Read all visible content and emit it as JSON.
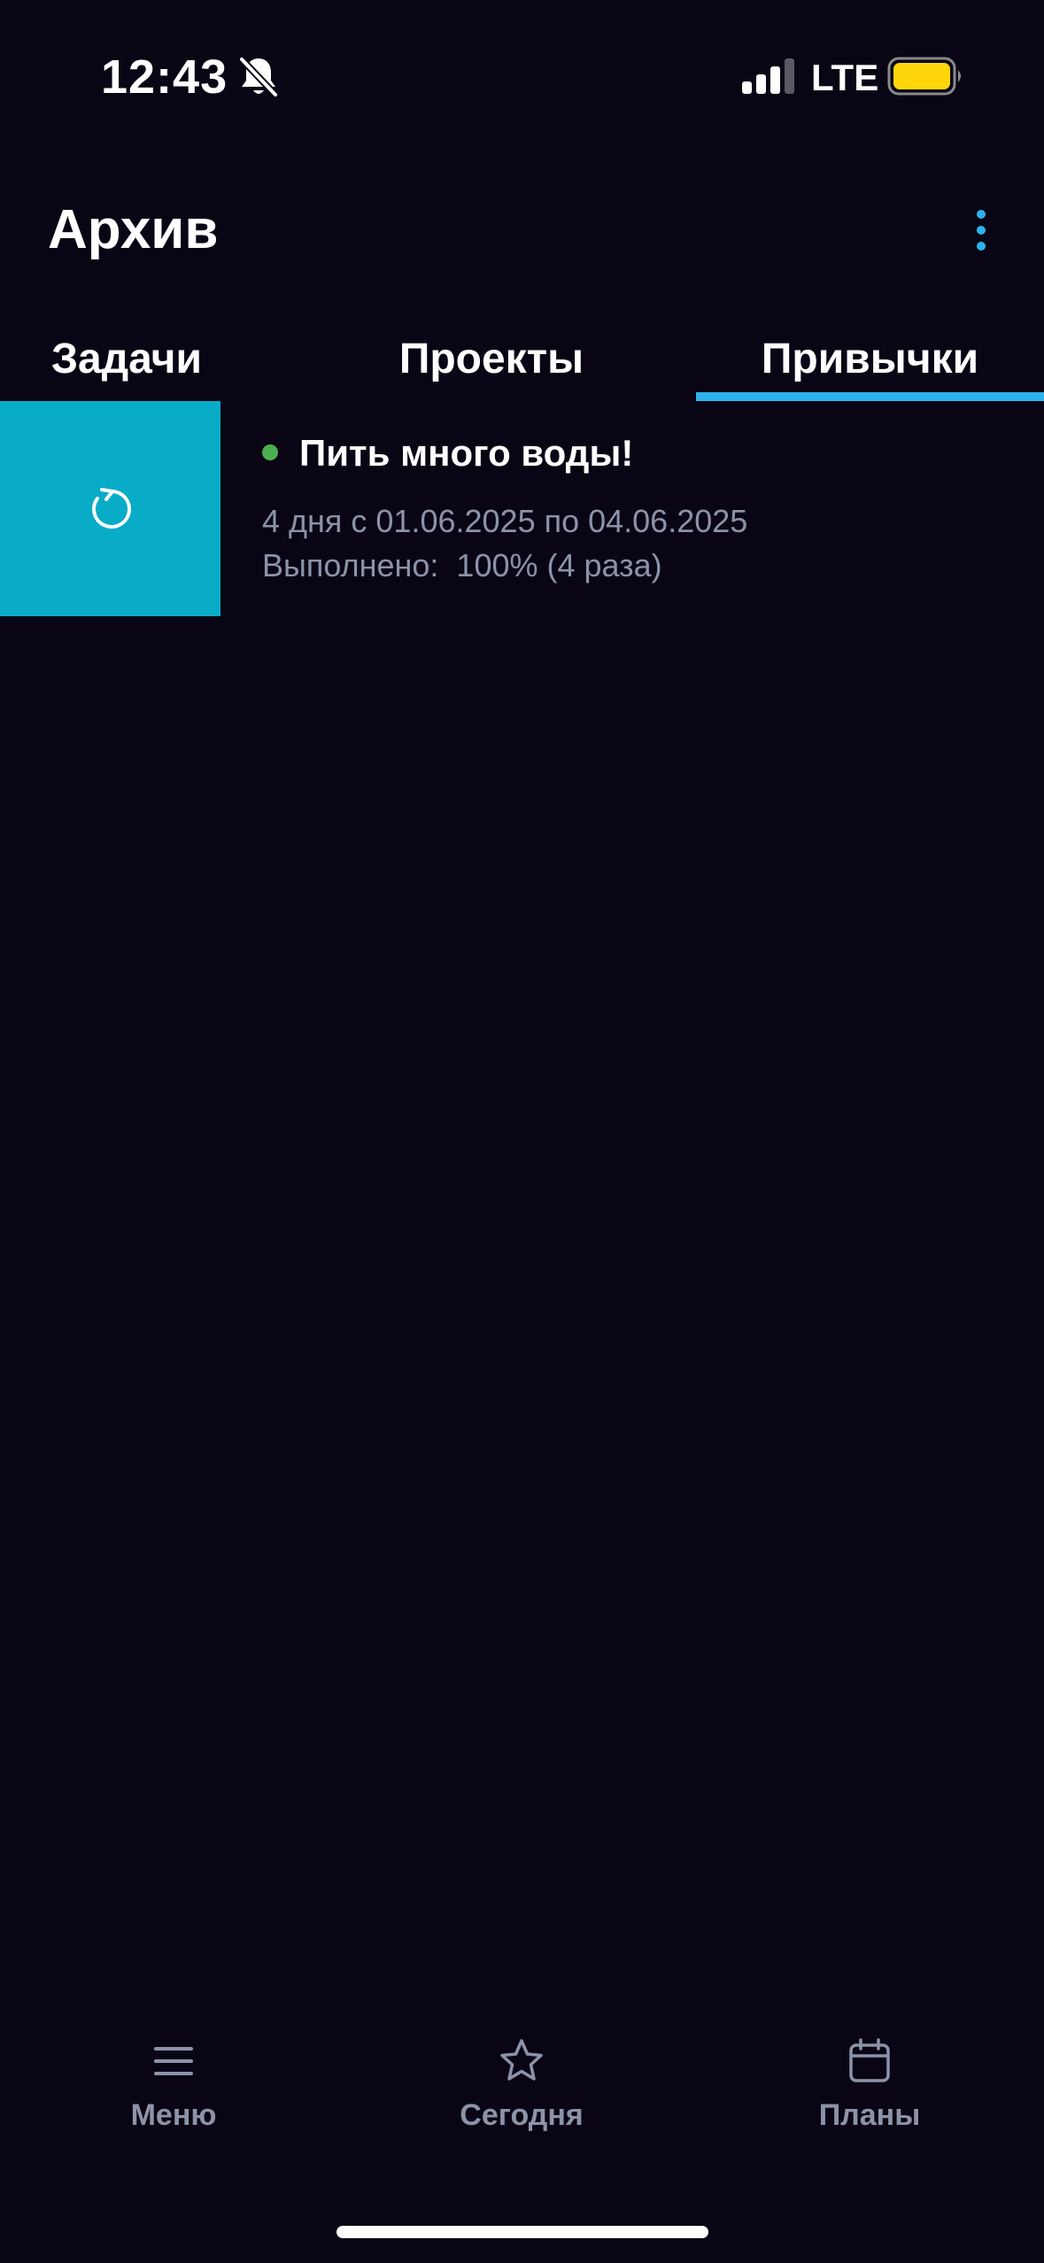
{
  "status_bar": {
    "time": "12:43",
    "network": "LTE",
    "battery_color": "#ffd60a",
    "icons": [
      "bell-slash-icon",
      "signal-icon",
      "battery-icon"
    ]
  },
  "header": {
    "title": "Архив",
    "more_icon": "more-vertical-icon"
  },
  "tabs": [
    {
      "label": "Задачи",
      "active": false
    },
    {
      "label": "Проекты",
      "active": false
    },
    {
      "label": "Привычки",
      "active": true
    }
  ],
  "habit": {
    "title": "Пить много воды!",
    "period": "4 дня с 01.06.2025 по 04.06.2025",
    "progress": "Выполнено:  100% (4 раза)",
    "status_color": "#4caf50",
    "action_icon": "restore-icon",
    "action_color": "#08acc7"
  },
  "bottom_nav": [
    {
      "label": "Меню",
      "icon": "menu-icon"
    },
    {
      "label": "Сегодня",
      "icon": "star-icon"
    },
    {
      "label": "Планы",
      "icon": "calendar-icon"
    }
  ],
  "colors": {
    "background": "#090514",
    "accent": "#2cb3ec",
    "muted_text": "#8c93a9"
  }
}
